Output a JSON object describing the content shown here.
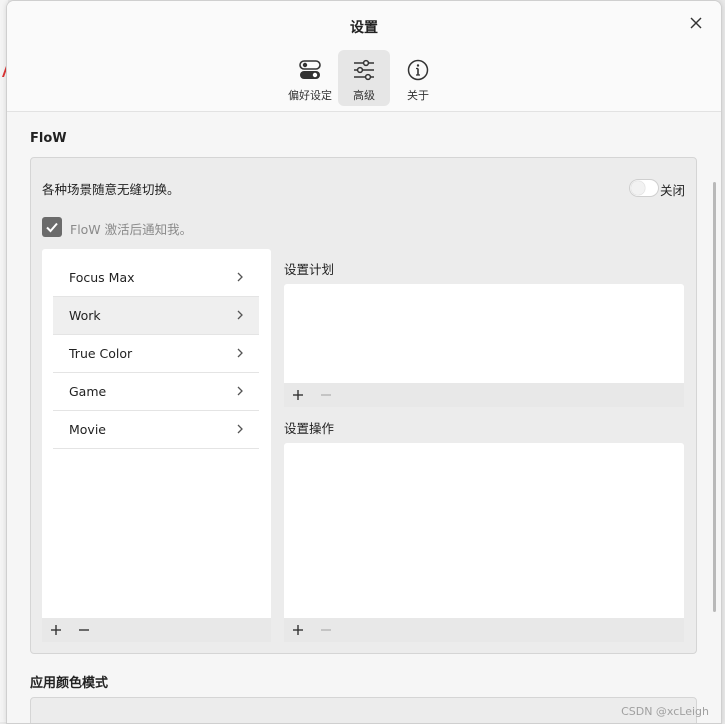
{
  "window": {
    "title": "设置"
  },
  "tabs": [
    {
      "label": "偏好设定",
      "icon": "toggle-settings-icon"
    },
    {
      "label": "高级",
      "icon": "sliders-icon",
      "active": true
    },
    {
      "label": "关于",
      "icon": "info-icon"
    }
  ],
  "flow": {
    "section_title": "FloW",
    "description": "各种场景随意无缝切换。",
    "toggle_label": "关闭",
    "toggle_on": false,
    "notify_label": "FloW 激活后通知我。",
    "notify_checked": true,
    "scenes": [
      {
        "label": "Focus Max"
      },
      {
        "label": "Work",
        "selected": true
      },
      {
        "label": "True Color"
      },
      {
        "label": "Game"
      },
      {
        "label": "Movie"
      }
    ],
    "plan_label": "设置计划",
    "actions_label": "设置操作"
  },
  "color_mode": {
    "section_title": "应用颜色模式"
  },
  "watermark": "CSDN @xcLeigh"
}
